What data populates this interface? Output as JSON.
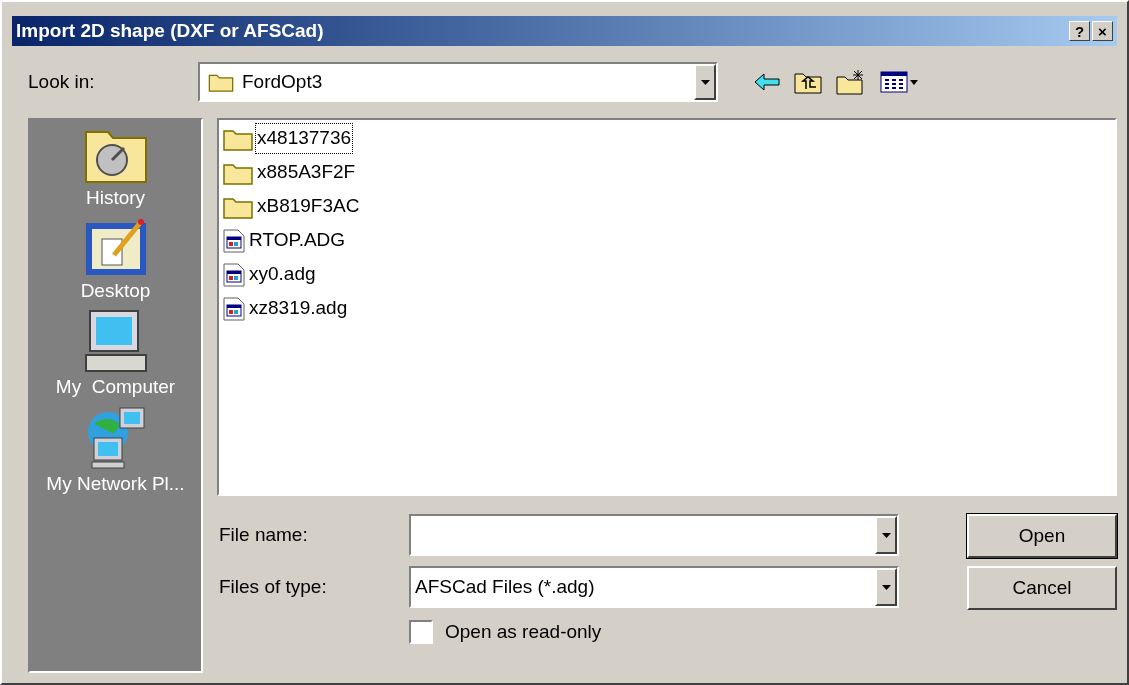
{
  "window": {
    "title": "Import 2D shape (DXF or AFSCad)",
    "title_buttons": [
      "?",
      "×"
    ]
  },
  "look_in": {
    "label": "Look in:",
    "value": "FordOpt3"
  },
  "places": [
    {
      "label": "History",
      "kind": "history"
    },
    {
      "label": "Desktop",
      "kind": "desktop"
    },
    {
      "label": "My  Computer",
      "kind": "computer"
    },
    {
      "label": "My Network Pl...",
      "kind": "network"
    }
  ],
  "files": [
    {
      "name": "x48137736",
      "kind": "folder",
      "selected": true
    },
    {
      "name": "x885A3F2F",
      "kind": "folder",
      "selected": false
    },
    {
      "name": "xB819F3AC",
      "kind": "folder",
      "selected": false
    },
    {
      "name": "RTOP.ADG",
      "kind": "file",
      "selected": false
    },
    {
      "name": "xy0.adg",
      "kind": "file",
      "selected": false
    },
    {
      "name": "xz8319.adg",
      "kind": "file",
      "selected": false
    }
  ],
  "file_name": {
    "label": "File name:"
  },
  "file_type": {
    "label": "Files of type:",
    "value": "AFSCad Files (*.adg)"
  },
  "read_only": {
    "label": "Open as read-only",
    "checked": false
  },
  "buttons": [
    {
      "label": "Open",
      "default": true
    },
    {
      "label": "Cancel",
      "default": false
    }
  ]
}
